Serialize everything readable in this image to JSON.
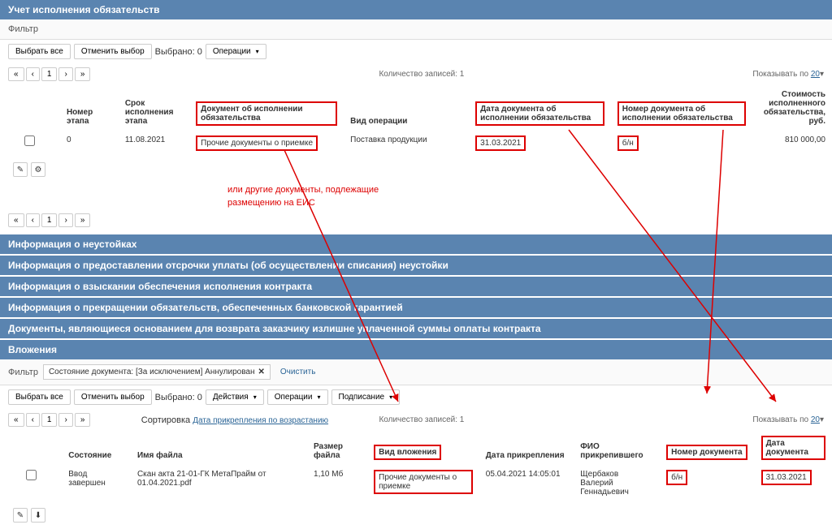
{
  "section1": {
    "title": "Учет исполнения обязательств",
    "filter_label": "Фильтр",
    "select_all": "Выбрать все",
    "deselect_all": "Отменить выбор",
    "selected_label": "Выбрано: 0",
    "operations": "Операции",
    "count_text": "Количество записей: 1",
    "show_label": "Показывать по",
    "show_count": "20",
    "headers": {
      "stage_num": "Номер этапа",
      "stage_date": "Срок исполнения этапа",
      "doc_exec": "Документ об исполнении обязательства",
      "op_type": "Вид операции",
      "doc_date": "Дата документа об исполнении обязательства",
      "doc_num": "Номер документа об исполнении обязательства",
      "cost": "Стоимость исполненного обязательства, руб."
    },
    "row": {
      "stage_num": "0",
      "stage_date": "11.08.2021",
      "doc_exec": "Прочие документы о приемке",
      "op_type": "Поставка продукции",
      "doc_date": "31.03.2021",
      "doc_num": "б/н",
      "cost": "810 000,00"
    },
    "annotation1": "или другие документы, подлежащие",
    "annotation2": "размещению на ЕИС"
  },
  "sections": {
    "penalty": "Информация о неустойках",
    "deferral": "Информация о предоставлении отсрочки уплаты (об осуществлении списания) неустойки",
    "collection": "Информация о взыскании обеспечения исполнения контракта",
    "termination": "Информация о прекращении обязательств, обеспеченных банковской гарантией",
    "refund": "Документы, являющиеся основанием для возврата заказчику излишне уплаченной суммы оплаты контракта"
  },
  "attachments": {
    "title": "Вложения",
    "filter_label": "Фильтр",
    "chip_label": "Состояние документа: [За исключением] Аннулирован",
    "clear": "Очистить",
    "select_all": "Выбрать все",
    "deselect_all": "Отменить выбор",
    "selected_label": "Выбрано: 0",
    "actions": "Действия",
    "operations": "Операции",
    "signing": "Подписание",
    "sort_label": "Сортировка",
    "sort_value": "Дата прикрепления по возрастанию",
    "count_text": "Количество записей: 1",
    "show_label": "Показывать по",
    "show_count": "20",
    "headers": {
      "state": "Состояние",
      "filename": "Имя файла",
      "filesize": "Размер файла",
      "attach_type": "Вид вложения",
      "attach_date": "Дата прикрепления",
      "attached_by": "ФИО прикрепившего",
      "doc_num": "Номер документа",
      "doc_date": "Дата документа"
    },
    "row": {
      "state": "Ввод завершен",
      "filename": "Скан акта 21-01-ГК МетаПрайм от 01.04.2021.pdf",
      "filesize": "1,10 Мб",
      "attach_type": "Прочие документы о приемке",
      "attach_date": "05.04.2021 14:05:01",
      "attached_by": "Щербаков Валерий Геннадьевич",
      "doc_num": "б/н",
      "doc_date": "31.03.2021"
    }
  }
}
